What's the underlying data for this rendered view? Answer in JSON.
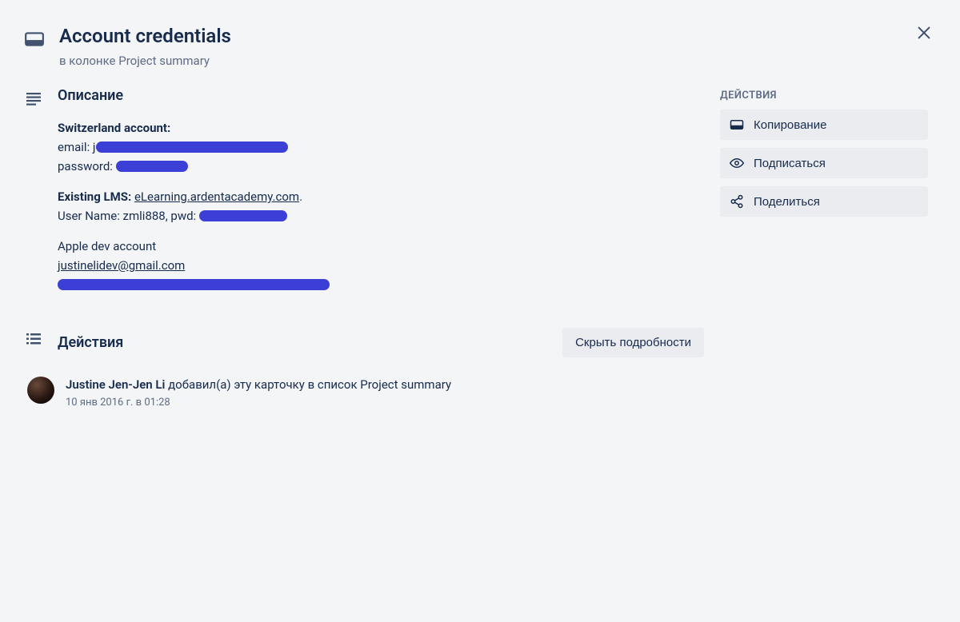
{
  "header": {
    "title": "Account credentials",
    "subtitle_prefix": "в колонке ",
    "subtitle_list": "Project summary"
  },
  "description": {
    "heading": "Описание",
    "block1_title": "Switzerland account:",
    "block1_email_label": "email: ",
    "block1_email_prefix": "j",
    "block1_password_label": "password: ",
    "block2_title": "Existing LMS:",
    "block2_link": "eLearning.ardentacademy.com",
    "block2_line2_a": "User Name: zmli888, pwd: ",
    "block3_title": "Apple dev account",
    "block3_email": "justinelidev@gmail.com"
  },
  "activity": {
    "heading": "Действия",
    "hide_details": "Скрыть подробности",
    "item1_author": "Justine Jen-Jen Li",
    "item1_action": " добавил(а) эту карточку в список Project summary",
    "item1_meta": "10 янв 2016 г. в 01:28"
  },
  "sidebar": {
    "title": "ДЕЙСТВИЯ",
    "copy": "Копирование",
    "subscribe": "Подписаться",
    "share": "Поделиться"
  }
}
